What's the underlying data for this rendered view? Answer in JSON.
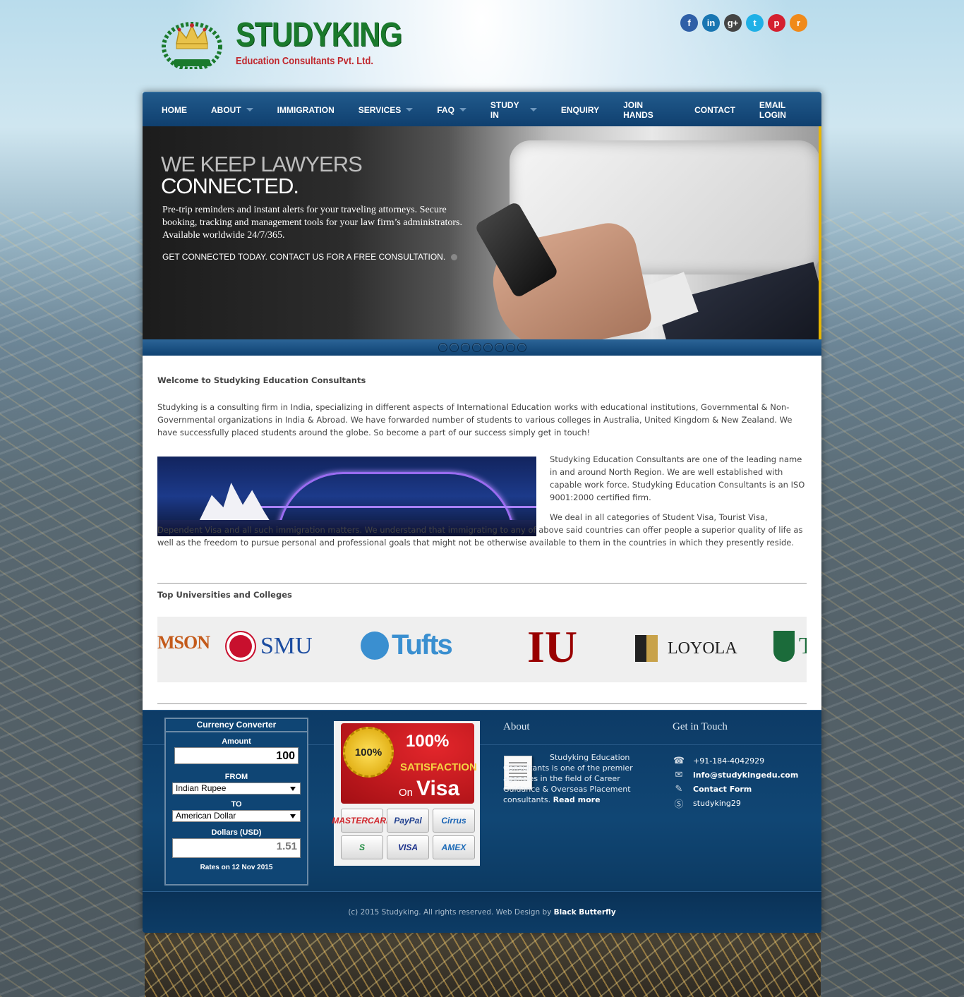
{
  "brand": {
    "name": "STUDYKING",
    "tagline": "Education Consultants Pvt. Ltd."
  },
  "social": [
    {
      "icon": "facebook-icon",
      "glyph": "f",
      "color": "#2f5fa7"
    },
    {
      "icon": "linkedin-icon",
      "glyph": "in",
      "color": "#1976b2"
    },
    {
      "icon": "google-plus-icon",
      "glyph": "g+",
      "color": "#444444"
    },
    {
      "icon": "twitter-icon",
      "glyph": "t",
      "color": "#1fb0e6"
    },
    {
      "icon": "pinterest-icon",
      "glyph": "p",
      "color": "#d4202f"
    },
    {
      "icon": "rss-icon",
      "glyph": "r",
      "color": "#f08a1a"
    }
  ],
  "nav": [
    {
      "label": "HOME",
      "dropdown": false
    },
    {
      "label": "ABOUT",
      "dropdown": true
    },
    {
      "label": "IMMIGRATION",
      "dropdown": false
    },
    {
      "label": "SERVICES",
      "dropdown": true
    },
    {
      "label": "FAQ",
      "dropdown": true
    },
    {
      "label": "STUDY IN",
      "dropdown": true
    },
    {
      "label": "ENQUIRY",
      "dropdown": false
    },
    {
      "label": "JOIN HANDS",
      "dropdown": false
    },
    {
      "label": "CONTACT",
      "dropdown": false
    },
    {
      "label": "EMAIL LOGIN",
      "dropdown": false
    }
  ],
  "slider": {
    "heading1": "WE KEEP LAWYERS",
    "heading2": "CONNECTED.",
    "text": "Pre-trip reminders and instant alerts for your traveling attorneys. Secure booking, tracking and management tools for your law firm’s administrators. Available worldwide 24/7/365.",
    "cta": "GET CONNECTED TODAY. CONTACT US FOR A FREE CONSULTATION.",
    "dots": 8,
    "accent": "#e8b600"
  },
  "content": {
    "welcome": "Welcome to Studyking Education Consultants",
    "para1": "Studyking is a consulting firm in India, specializing in different aspects of International Education works with educational institutions, Governmental & Non-Governmental organizations in India & Abroad. We have forwarded number of students to various colleges in Australia, United Kingdom & New Zealand. We have successfully placed students around the globe. So become a part of our success simply get in touch!",
    "para2": "Studyking Education Consultants are one of the leading name in and around North Region. We are well established with capable work force. Studyking  Education Consultants is an ISO 9001:2000 certified firm.",
    "para3": "We deal in all categories of Student Visa, Tourist Visa, Dependent Visa and all such immigration matters. We understand that immigrating to any of above said countries can offer people a superior quality of life as well as the freedom to pursue personal and professional goals that might not be otherwise available to them in the countries in which they presently reside.",
    "top_unis": "Top Universities and Colleges",
    "universities": [
      "MSON",
      "SMU",
      "Tufts",
      "IU",
      "LOYOLA",
      "T"
    ]
  },
  "currency": {
    "title": "Currency Converter",
    "amount_label": "Amount",
    "amount": "100",
    "from_label": "FROM",
    "from": "Indian Rupee",
    "to_label": "TO",
    "to": "American Dollar",
    "result_label": "Dollars (USD)",
    "result": "1.51",
    "rates": "Rates on 12 Nov 2015"
  },
  "badge": {
    "seal": "100%",
    "pct": "100%",
    "satisfaction": "SATISFACTION",
    "on": "On",
    "visa": "Visa",
    "cards": [
      {
        "name": "MASTERCARD",
        "color": "#d0242a"
      },
      {
        "name": "PayPal",
        "color": "#1f3f8e"
      },
      {
        "name": "Cirrus",
        "color": "#1a64b4"
      },
      {
        "name": "S",
        "color": "#1a8a3c"
      },
      {
        "name": "VISA",
        "color": "#1a2f8a"
      },
      {
        "name": "AMEX",
        "color": "#1d6bb8"
      }
    ]
  },
  "about": {
    "heading": "About",
    "text": "Studyking Education Consultants is one of the premier agencies in the field of Career Guidance & Overseas Placement consultants.",
    "read_more": "Read more"
  },
  "touch": {
    "heading": "Get in Touch",
    "phone": "+91-184-4042929",
    "email": "info@studykingedu.com",
    "form": "Contact Form",
    "skype": "studyking29"
  },
  "copyright": {
    "text": "(c) 2015 Studyking. All rights reserved. Web Design by",
    "designer": "Black Butterfly"
  }
}
